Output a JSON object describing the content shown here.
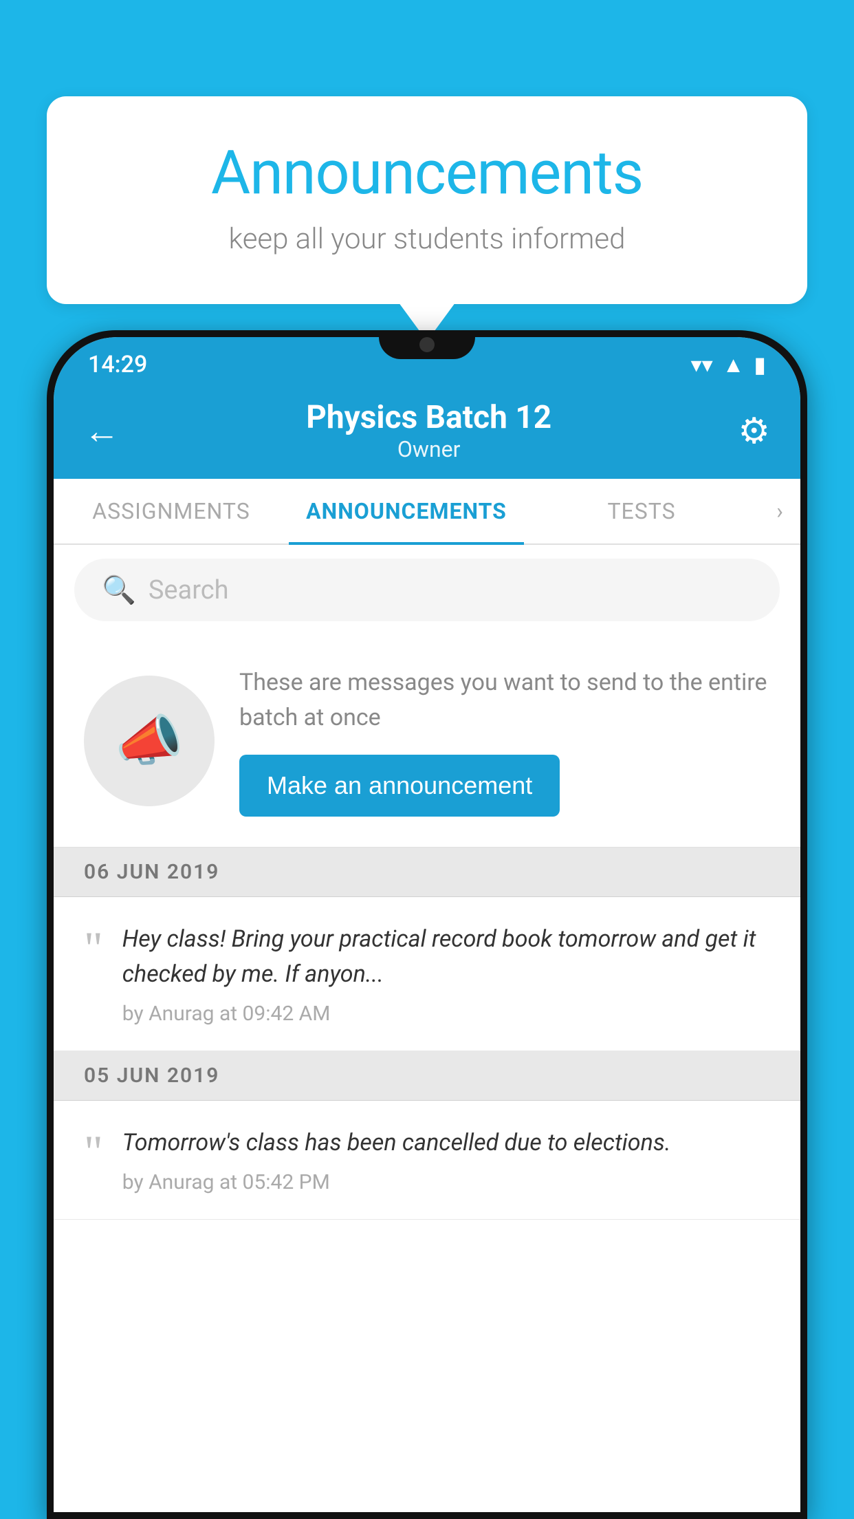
{
  "background_color": "#1db6e8",
  "speech_bubble": {
    "title": "Announcements",
    "subtitle": "keep all your students informed"
  },
  "status_bar": {
    "time": "14:29",
    "wifi": "▼",
    "signal": "▲",
    "battery": "▮"
  },
  "header": {
    "back_label": "←",
    "title": "Physics Batch 12",
    "subtitle": "Owner",
    "gear_label": "⚙"
  },
  "tabs": [
    {
      "label": "ASSIGNMENTS",
      "active": false
    },
    {
      "label": "ANNOUNCEMENTS",
      "active": true
    },
    {
      "label": "TESTS",
      "active": false
    }
  ],
  "tabs_more": "›",
  "search": {
    "placeholder": "Search"
  },
  "promo": {
    "description": "These are messages you want to send to the entire batch at once",
    "button_label": "Make an announcement"
  },
  "announcements": [
    {
      "date": "06  JUN  2019",
      "text": "Hey class! Bring your practical record book tomorrow and get it checked by me. If anyon...",
      "meta": "by Anurag at 09:42 AM"
    },
    {
      "date": "05  JUN  2019",
      "text": "Tomorrow's class has been cancelled due to elections.",
      "meta": "by Anurag at 05:42 PM"
    }
  ]
}
